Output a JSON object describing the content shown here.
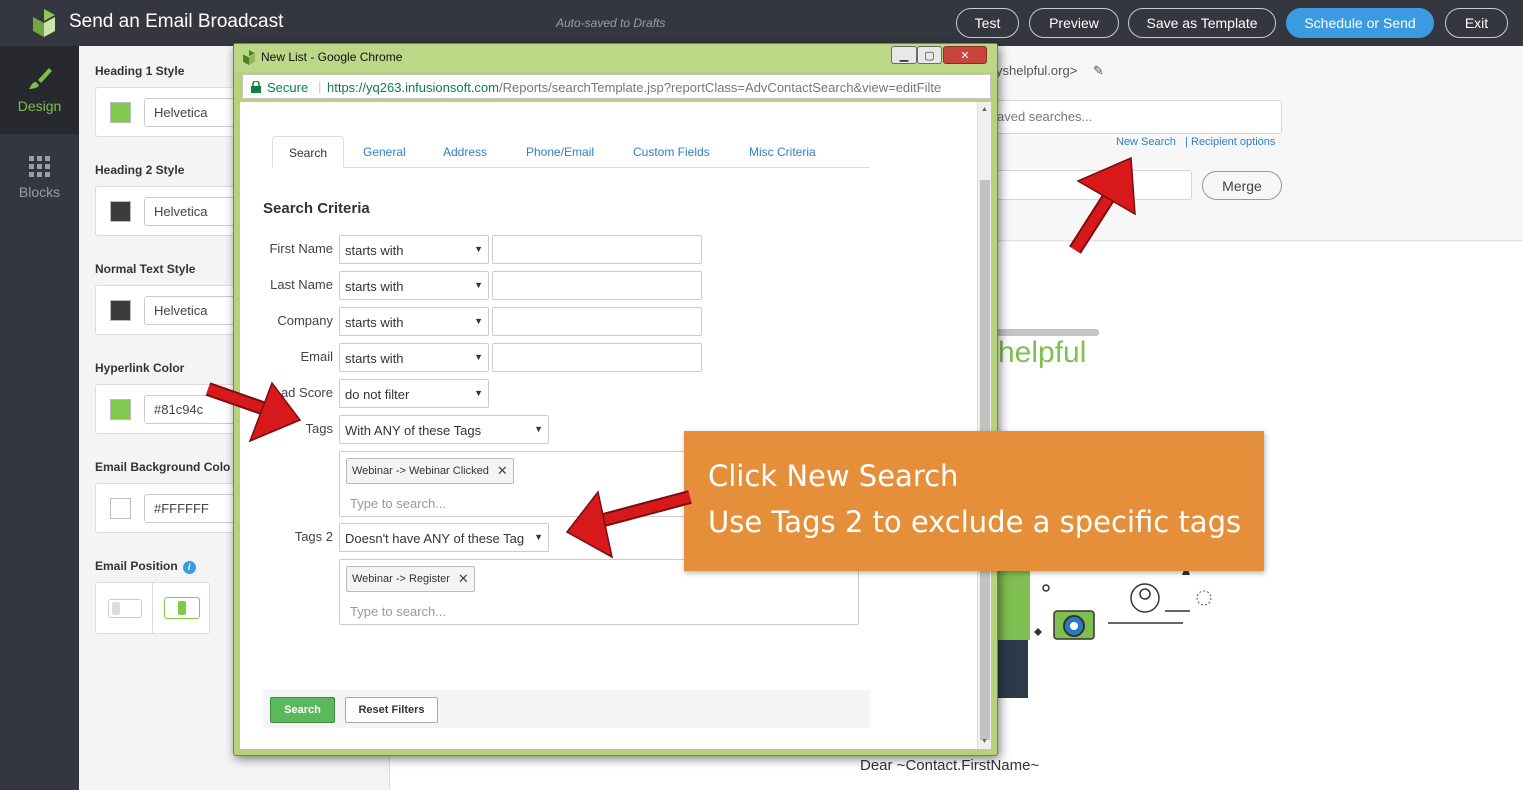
{
  "header": {
    "title": "Send an Email Broadcast",
    "autosave": "Auto-saved to Drafts",
    "buttons": {
      "test": "Test",
      "preview": "Preview",
      "save_template": "Save as Template",
      "schedule": "Schedule or Send",
      "exit": "Exit"
    }
  },
  "rail": {
    "design": "Design",
    "blocks": "Blocks"
  },
  "panel": {
    "h1_label": "Heading 1 Style",
    "h1_font": "Helvetica",
    "h1_color": "#81c94c",
    "h2_label": "Heading 2 Style",
    "h2_font": "Helvetica",
    "h2_color": "#3c3c3c",
    "normal_label": "Normal Text Style",
    "normal_font": "Helvetica",
    "normal_color": "#3c3c3c",
    "link_label": "Hyperlink Color",
    "link_value": "#81c94c",
    "bg_label": "Email Background Colo",
    "bg_value": "#FFFFFF",
    "position_label": "Email Position"
  },
  "right": {
    "from_text": "yshelpful.org>",
    "saved_search_ph": "aved searches...",
    "new_search": "New Search",
    "recipient_options": "Recipient options",
    "merge": "Merge",
    "helpful": "helpful",
    "dear": "Dear ~Contact.FirstName~"
  },
  "popup": {
    "title": "New List - Google Chrome",
    "secure": "Secure",
    "url_scheme": "https://",
    "url_host": "yq263.infusionsoft.com",
    "url_path": "/Reports/searchTemplate.jsp?reportClass=AdvContactSearch&view=editFilte",
    "tabs": [
      "Search",
      "General",
      "Address",
      "Phone/Email",
      "Custom Fields",
      "Misc Criteria"
    ],
    "criteria_title": "Search Criteria",
    "rows": [
      {
        "label": "First Name",
        "op": "starts with"
      },
      {
        "label": "Last Name",
        "op": "starts with"
      },
      {
        "label": "Company",
        "op": "starts with"
      },
      {
        "label": "Email",
        "op": "starts with"
      }
    ],
    "lead_score": {
      "label": "ad Score",
      "op": "do not filter"
    },
    "tags": {
      "label": "Tags",
      "op": "With ANY of these Tags",
      "chip": "Webinar -> Webinar Clicked",
      "placeholder": "Type to search..."
    },
    "tags2": {
      "label": "Tags 2",
      "op": "Doesn't have ANY of these Tag",
      "chip": "Webinar -> Register",
      "placeholder": "Type to search..."
    },
    "search_btn": "Search",
    "reset_btn": "Reset Filters"
  },
  "callout": {
    "line1": "Click New Search",
    "line2": "Use Tags 2 to exclude a specific tags"
  },
  "colors": {
    "accent_green": "#81c94c",
    "primary_blue": "#3a9be0",
    "callout_orange": "#e58f3a",
    "arrow_red": "#d7191c"
  }
}
